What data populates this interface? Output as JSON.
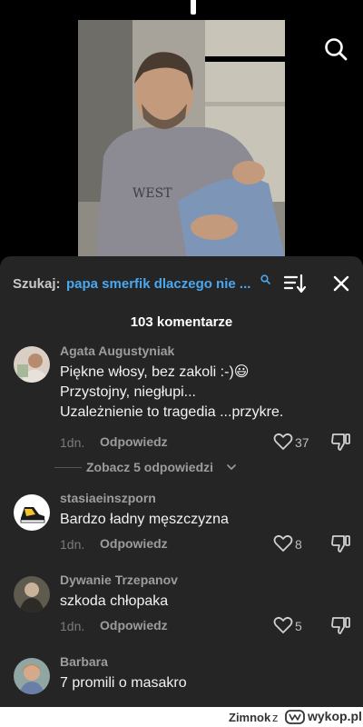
{
  "video": {
    "thumbnail_icon": "man-sitting-on-steps-photo"
  },
  "search": {
    "label": "Szukaj:",
    "query": "papa smerfik dlaczego nie ...",
    "search_icon": "search-icon",
    "sort_icon": "sort-icon",
    "close_icon": "close-icon"
  },
  "comments_count": "103 komentarze",
  "comments": [
    {
      "author": "Agata Augustyniak",
      "lines": [
        "Piękne włosy, bez zakoli :-)😃",
        "Przystojny, niegłupi...",
        "Uzależnienie to tragedia ...przykre."
      ],
      "time": "1dn.",
      "reply_label": "Odpowiedz",
      "likes": "37"
    },
    {
      "author": "stasiaeinszporn",
      "lines": [
        "Bardzo ładny męszczyzna"
      ],
      "time": "1dn.",
      "reply_label": "Odpowiedz",
      "likes": "8"
    },
    {
      "author": "Dywanie Trzepanov",
      "lines": [
        "szkoda chłopaka"
      ],
      "time": "1dn.",
      "reply_label": "Odpowiedz",
      "likes": "5"
    },
    {
      "author": "Barbara",
      "lines": [
        "7 promili o masakro"
      ]
    }
  ],
  "replies_toggle": "Zobacz 5 odpowiedzi",
  "footer": {
    "user": "Zimnok",
    "z": "z",
    "domain": "wykop.pl"
  },
  "colors": {
    "sheet_bg": "#252525",
    "query_blue": "#4aa8f0",
    "emoji_yellow": "#f5c518"
  }
}
